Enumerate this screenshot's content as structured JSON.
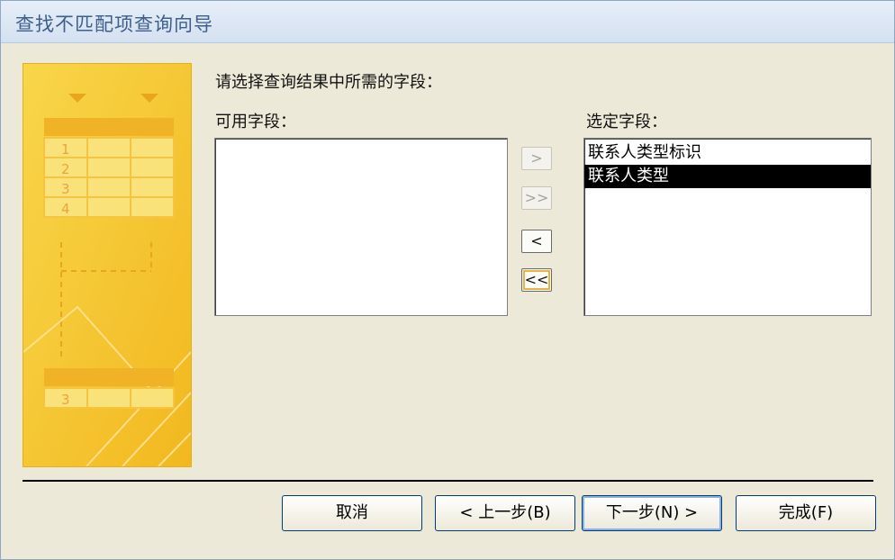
{
  "window": {
    "title": "查找不匹配项查询向导"
  },
  "illustration": {
    "rows": [
      "1",
      "2",
      "3",
      "4"
    ],
    "result_row": "3"
  },
  "prompt": "请选择查询结果中所需的字段：",
  "available": {
    "label": "可用字段：",
    "items": []
  },
  "selected": {
    "label": "选定字段：",
    "items": [
      {
        "text": "联系人类型标识",
        "selected": false
      },
      {
        "text": "联系人类型",
        "selected": true
      }
    ]
  },
  "move_buttons": {
    "add": ">",
    "add_all": ">>",
    "remove": "<",
    "remove_all": "<<"
  },
  "buttons": {
    "cancel": "取消",
    "back": "< 上一步(B)",
    "next": "下一步(N) >",
    "finish": "完成(F)"
  }
}
